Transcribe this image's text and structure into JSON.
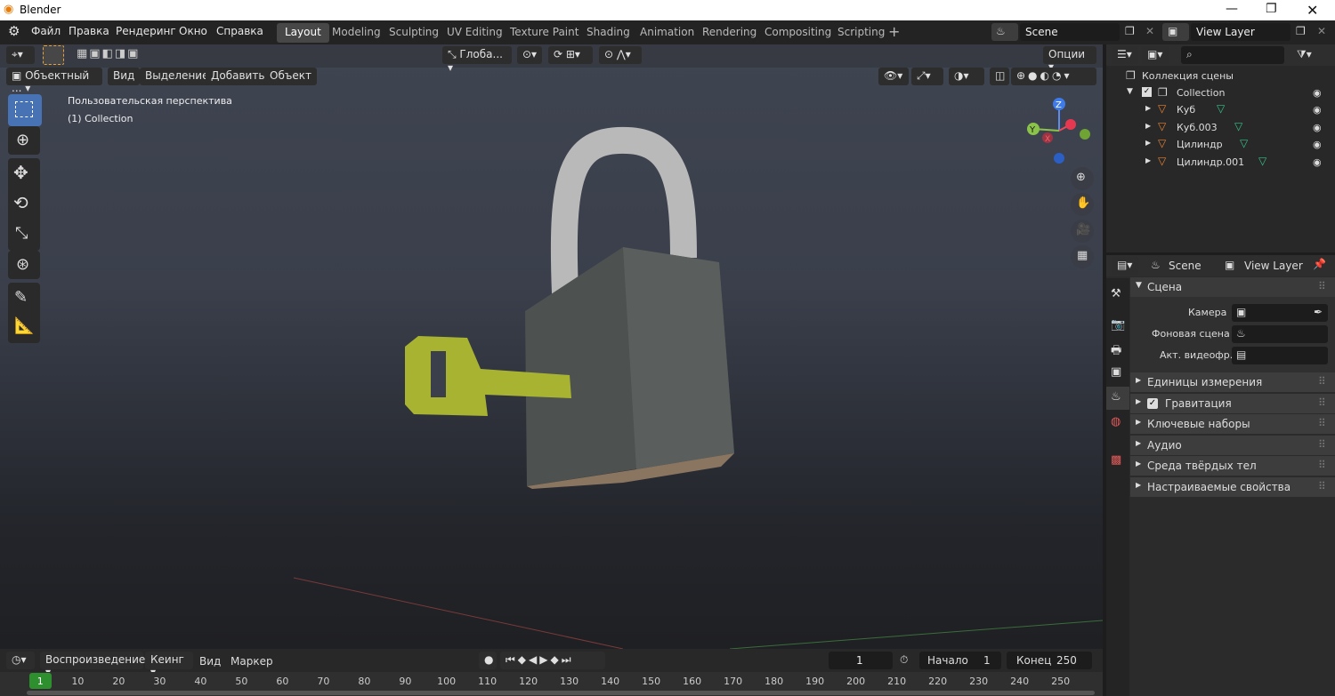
{
  "app": {
    "title": "Blender"
  },
  "menu": [
    "Файл",
    "Правка",
    "Рендеринг",
    "Окно",
    "Справка"
  ],
  "workspaces": [
    "Layout",
    "Modeling",
    "Sculpting",
    "UV Editing",
    "Texture Paint",
    "Shading",
    "Animation",
    "Rendering",
    "Compositing",
    "Scripting"
  ],
  "scene": {
    "scene_name": "Scene",
    "view_layer": "View Layer"
  },
  "viewport": {
    "mode": "Объектный ...",
    "header_menu": [
      "Вид",
      "Выделение",
      "Добавить",
      "Объект"
    ],
    "orientation": "Глоба...",
    "options": "Опции",
    "view_name": "Пользовательская перспектива",
    "collection_info": "(1) Collection",
    "gizmo": {
      "x": "X",
      "y": "Y",
      "z": "Z"
    }
  },
  "outliner": {
    "root": "Коллекция сцены",
    "collection": "Collection",
    "objects": [
      "Куб",
      "Куб.003",
      "Цилиндр",
      "Цилиндр.001"
    ]
  },
  "properties": {
    "tab_scene": "Scene",
    "tab_view_layer": "View Layer",
    "section_title": "Сцена",
    "fields": [
      {
        "label": "Камера"
      },
      {
        "label": "Фоновая сцена"
      },
      {
        "label": "Акт. видеофр."
      }
    ],
    "subsections": [
      "Единицы измерения",
      "Гравитация",
      "Ключевые наборы",
      "Аудио",
      "Среда твёрдых тел",
      "Настраиваемые свойства"
    ],
    "gravity_checked": true
  },
  "timeline": {
    "playback": "Воспроизведение",
    "keying": "Кеинг",
    "view": "Вид",
    "marker": "Маркер",
    "current_frame": "1",
    "start_label": "Начало",
    "start": "1",
    "end_label": "Конец",
    "end": "250",
    "ticks": [
      "1",
      "10",
      "20",
      "30",
      "40",
      "50",
      "60",
      "70",
      "80",
      "90",
      "100",
      "110",
      "120",
      "130",
      "140",
      "150",
      "160",
      "170",
      "180",
      "190",
      "200",
      "210",
      "220",
      "230",
      "240",
      "250"
    ]
  },
  "colors": {
    "key": "#a8b236",
    "lock_body": "#4f5351",
    "shackle": "#bcbcbc",
    "accent": "#4772b3",
    "frame_badge": "#2e8f2e"
  }
}
